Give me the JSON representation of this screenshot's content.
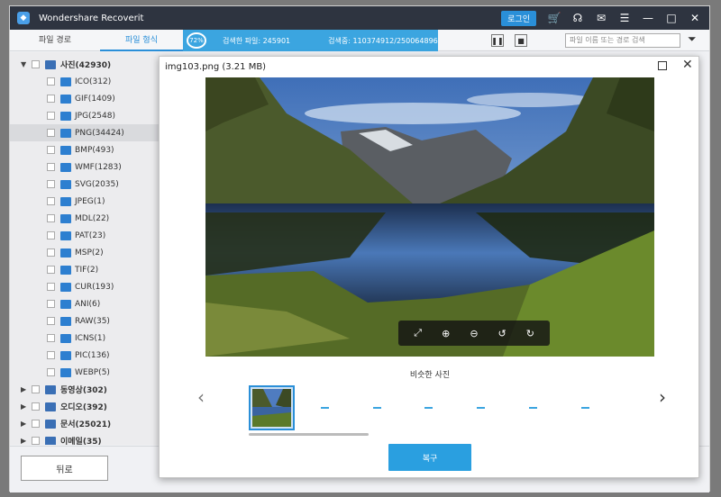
{
  "app": {
    "title": "Wondershare Recoverit",
    "login": "로그인"
  },
  "toolbar": {
    "tab_path": "파일 경로",
    "tab_type": "파일 형식",
    "progress_pct": "72%",
    "found_files": "검색한 파일: 245901",
    "scanning": "검색중: 110374912/250064896",
    "search_placeholder": "파일 이름 또는 경로 검색"
  },
  "tree": {
    "root": {
      "label": "사진(42930)"
    },
    "items": [
      {
        "label": "ICO(312)"
      },
      {
        "label": "GIF(1409)"
      },
      {
        "label": "JPG(2548)"
      },
      {
        "label": "PNG(34424)"
      },
      {
        "label": "BMP(493)"
      },
      {
        "label": "WMF(1283)"
      },
      {
        "label": "SVG(2035)"
      },
      {
        "label": "JPEG(1)"
      },
      {
        "label": "MDL(22)"
      },
      {
        "label": "PAT(23)"
      },
      {
        "label": "MSP(2)"
      },
      {
        "label": "TIF(2)"
      },
      {
        "label": "CUR(193)"
      },
      {
        "label": "ANI(6)"
      },
      {
        "label": "RAW(35)"
      },
      {
        "label": "ICNS(1)"
      },
      {
        "label": "PIC(136)"
      },
      {
        "label": "WEBP(5)"
      }
    ],
    "others": [
      {
        "label": "동영상(302)"
      },
      {
        "label": "오디오(392)"
      },
      {
        "label": "문서(25021)"
      },
      {
        "label": "이메일(35)"
      }
    ]
  },
  "bottom": {
    "back": "뒤로"
  },
  "preview": {
    "title": "img103.png (3.21 MB)",
    "similar_label": "비슷한 사진",
    "recover": "복구"
  }
}
